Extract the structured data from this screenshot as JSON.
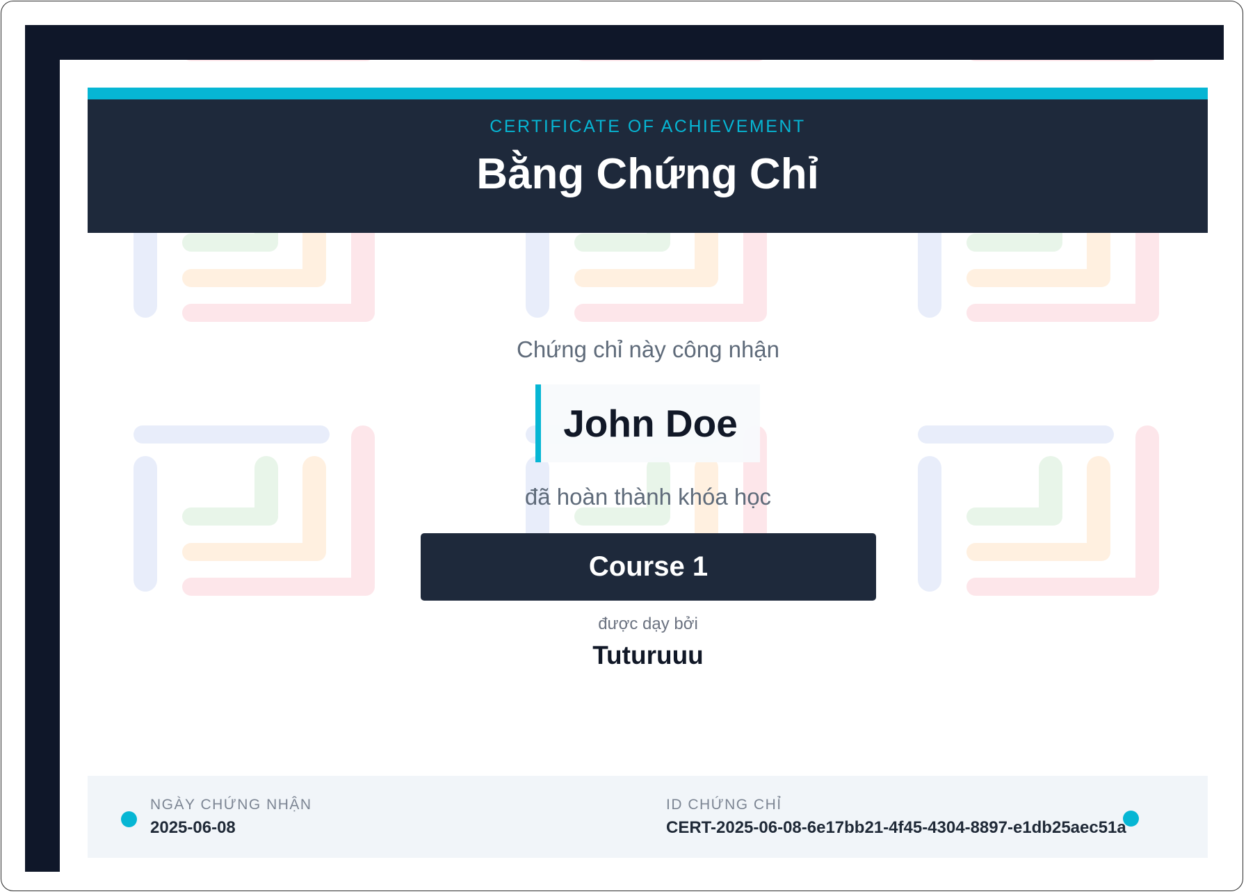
{
  "header": {
    "subtitle": "CERTIFICATE OF ACHIEVEMENT",
    "title": "Bằng Chứng Chỉ"
  },
  "body": {
    "recognize_text": "Chứng chỉ này công nhận",
    "recipient_name": "John Doe",
    "completed_text": "đã hoàn thành khóa học",
    "course_name": "Course 1",
    "taught_by_text": "được dạy bởi",
    "instructor_name": "Tuturuuu"
  },
  "footer": {
    "date_label": "NGÀY CHỨNG NHẬN",
    "date_value": "2025-06-08",
    "id_label": "ID CHỨNG CHỈ",
    "id_value": "CERT-2025-06-08-6e17bb21-4f45-4304-8897-e1db25aec51a"
  },
  "colors": {
    "accent": "#06b6d4",
    "dark": "#1e293b",
    "frame": "#0f1729",
    "footer_bg": "#f1f5f9"
  }
}
